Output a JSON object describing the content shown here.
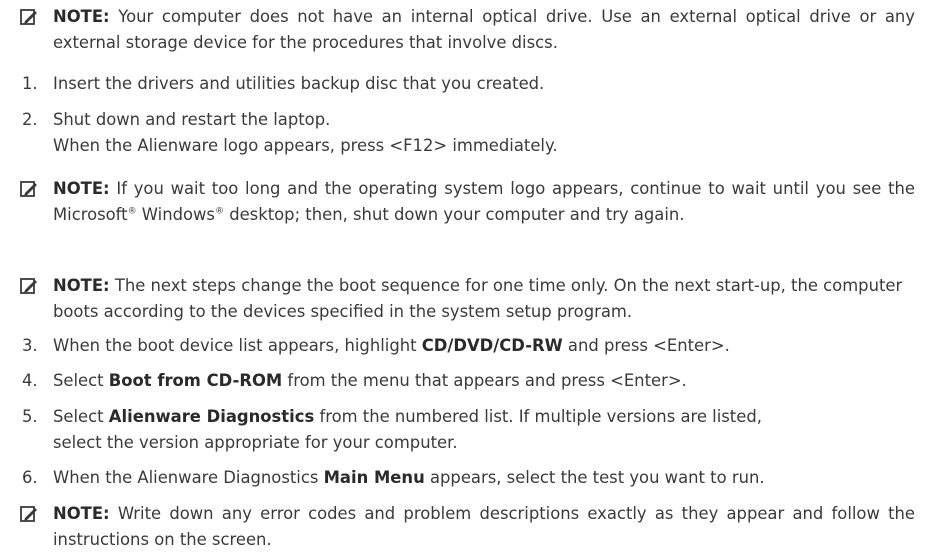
{
  "notes": {
    "label": "NOTE:",
    "n1": "Your computer does not have an internal optical drive. Use an external optical drive or any external storage device for the procedures that involve discs.",
    "n2_a": "If you wait too long and the operating system logo appears, continue to wait until you see the Microsoft",
    "n2_reg1": "®",
    "n2_b": " Windows",
    "n2_reg2": "®",
    "n2_c": " desktop; then, shut down your computer and try again.",
    "n3": "The next steps change the boot sequence for one time only. On the next start-up, the computer boots according to the devices specified in the system setup program.",
    "n4": "Write down any error codes and problem descriptions exactly as they appear and follow the instructions on the screen."
  },
  "steps": [
    {
      "num": "1.",
      "text": "Insert the drivers and utilities backup disc that you created."
    },
    {
      "num": "2.",
      "line1": "Shut down and restart the laptop.",
      "line2": "When the Alienware logo appears, press <F12> immediately."
    },
    {
      "num": "3.",
      "pre": "When the boot device list appears, highlight ",
      "bold": "CD/DVD/CD-RW",
      "post": " and press <Enter>."
    },
    {
      "num": "4.",
      "pre": "Select ",
      "bold": "Boot from CD-ROM",
      "post": " from the menu that appears and press <Enter>."
    },
    {
      "num": "5.",
      "pre": "Select ",
      "bold": "Alienware Diagnostics",
      "post": " from the numbered list. If multiple versions are listed,",
      "line2": "select the version appropriate for your computer."
    },
    {
      "num": "6.",
      "pre": "When the Alienware Diagnostics ",
      "bold": "Main Menu",
      "post": " appears, select the test you want to run."
    }
  ]
}
